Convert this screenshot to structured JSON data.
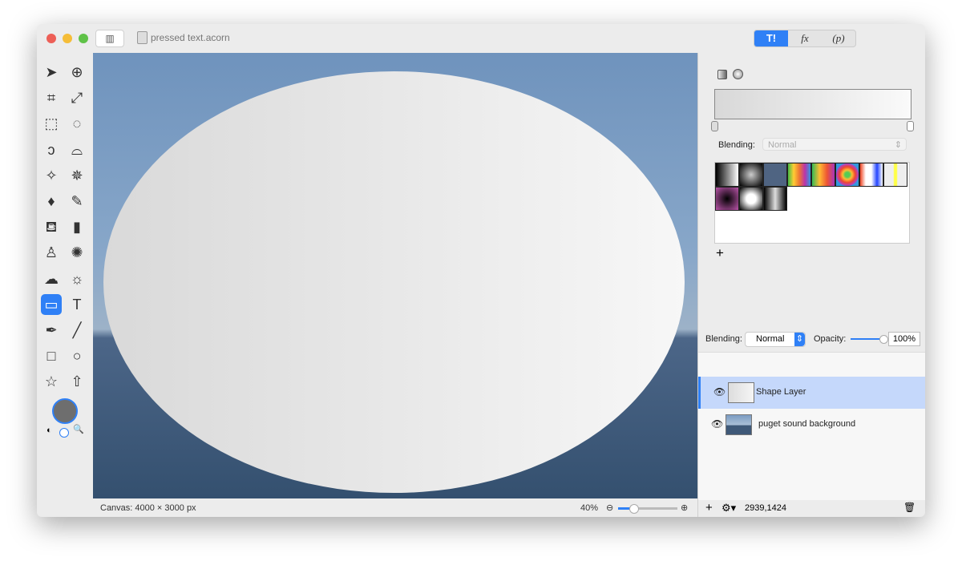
{
  "window": {
    "title": "pressed text.acorn"
  },
  "inspector_tabs": [
    {
      "label": "T!",
      "active": true
    },
    {
      "label": "fx"
    },
    {
      "label": "(p)"
    }
  ],
  "tools": [
    "arrow-tool",
    "zoom-tool",
    "crop-tool",
    "transform-tool",
    "rect-select-tool",
    "ellipse-select-tool",
    "lasso-tool",
    "polygon-lasso-tool",
    "magic-wand-tool",
    "color-wand-tool",
    "brush-tool",
    "pencil-tool",
    "paint-bucket-tool",
    "eraser-tool",
    "clone-stamp-tool",
    "smudge-tool",
    "cloud-tool",
    "sun-tool",
    "gradient-tool",
    "text-tool",
    "pen-tool",
    "line-tool",
    "rectangle-tool",
    "oval-tool",
    "star-tool",
    "arrow-shape-tool"
  ],
  "gradient": {
    "blending_label": "Blending:",
    "blending_value": "Normal",
    "add_label": "+",
    "colors": [
      "#d8d8d8",
      "#fafafa"
    ]
  },
  "layers_header": {
    "blending_label": "Blending:",
    "blending_value": "Normal",
    "opacity_label": "Opacity:",
    "opacity_value": "100%",
    "opacity": 100
  },
  "layers": [
    {
      "name": "Shape Layer",
      "selected": true
    },
    {
      "name": "puget sound background",
      "selected": false
    }
  ],
  "status": {
    "canvas": "Canvas: 4000 × 3000 px",
    "zoom": "40%",
    "coords": "2939,1424"
  },
  "accent": "#2f80f6"
}
